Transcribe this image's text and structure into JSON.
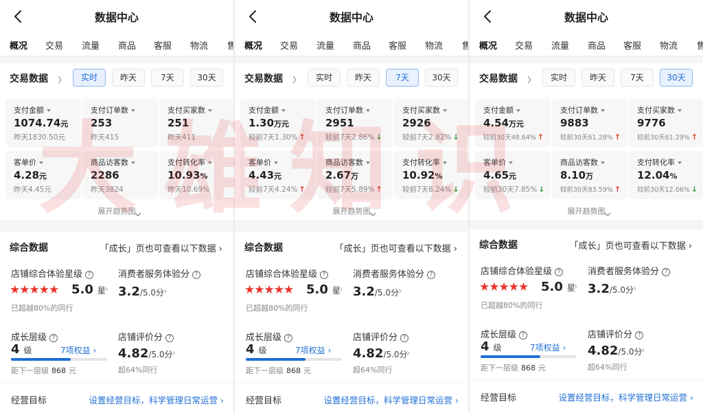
{
  "watermark": "大雄知识",
  "panels": [
    {
      "title": "数据中心",
      "tabs": [
        "概况",
        "交易",
        "流量",
        "商品",
        "客服",
        "物流",
        "售"
      ],
      "trade": {
        "title": "交易数据",
        "periods": [
          "实时",
          "昨天",
          "7天",
          "30天"
        ],
        "active_period": "实时",
        "metrics": [
          {
            "label": "支付金额",
            "value": "1074.74",
            "unit": "元",
            "sub": "昨天1830.50元",
            "trend": ""
          },
          {
            "label": "支付订单数",
            "value": "253",
            "unit": "",
            "sub": "昨天415",
            "trend": ""
          },
          {
            "label": "支付买家数",
            "value": "251",
            "unit": "",
            "sub": "昨天411",
            "trend": ""
          },
          {
            "label": "客单价",
            "value": "4.28",
            "unit": "元",
            "sub": "昨天4.45元",
            "trend": ""
          },
          {
            "label": "商品访客数",
            "value": "2286",
            "unit": "",
            "sub": "昨天3824",
            "trend": ""
          },
          {
            "label": "支付转化率",
            "value": "10.93",
            "unit": "%",
            "sub": "昨天10.69%",
            "trend": ""
          }
        ],
        "expand": "展开趋势图"
      },
      "summary": {
        "title": "综合数据",
        "link": "「成长」页也可查看以下数据",
        "rating_label": "店铺综合体验星级",
        "stars": "★★★★★",
        "rating_value": "5.0",
        "rating_unit": "星",
        "rating_note": "已超越80%的同行",
        "service_label": "消费者服务体验分",
        "service_value": "3.2",
        "service_unit": "/5.0分",
        "growth_label": "成长层级",
        "growth_value": "4",
        "growth_unit": "级",
        "growth_link": "7项权益",
        "growth_progress": 0.62,
        "growth_note_pre": "距下一层级",
        "growth_note_val": "868",
        "growth_note_unit": "元",
        "review_label": "店铺评价分",
        "review_value": "4.82",
        "review_unit": "/5.0分",
        "review_note": "超64%同行",
        "goal_label": "经营目标",
        "goal_link": "设置经营目标，科学管理日常运营"
      }
    },
    {
      "title": "数据中心",
      "tabs": [
        "概况",
        "交易",
        "流量",
        "商品",
        "客服",
        "物流",
        "售"
      ],
      "trade": {
        "title": "交易数据",
        "periods": [
          "实时",
          "昨天",
          "7天",
          "30天"
        ],
        "active_period": "7天",
        "metrics": [
          {
            "label": "支付金额",
            "value": "1.30",
            "unit": "万元",
            "sub": "较前7天1.30%",
            "trend": "up"
          },
          {
            "label": "支付订单数",
            "value": "2951",
            "unit": "",
            "sub": "较前7天2.86%",
            "trend": "down"
          },
          {
            "label": "支付买家数",
            "value": "2926",
            "unit": "",
            "sub": "较前7天2.82%",
            "trend": "down"
          },
          {
            "label": "客单价",
            "value": "4.43",
            "unit": "元",
            "sub": "较前7天4.24%",
            "trend": "up"
          },
          {
            "label": "商品访客数",
            "value": "2.67",
            "unit": "万",
            "sub": "较前7天5.89%",
            "trend": "up"
          },
          {
            "label": "支付转化率",
            "value": "10.92",
            "unit": "%",
            "sub": "较前7天8.24%",
            "trend": "down"
          }
        ],
        "expand": "展开趋势图"
      },
      "summary": {
        "title": "综合数据",
        "link": "「成长」页也可查看以下数据",
        "rating_label": "店铺综合体验星级",
        "stars": "★★★★★",
        "rating_value": "5.0",
        "rating_unit": "星",
        "rating_note": "已超越80%的同行",
        "service_label": "消费者服务体验分",
        "service_value": "3.2",
        "service_unit": "/5.0分",
        "growth_label": "成长层级",
        "growth_value": "4",
        "growth_unit": "级",
        "growth_link": "7项权益",
        "growth_progress": 0.62,
        "growth_note_pre": "距下一层级",
        "growth_note_val": "868",
        "growth_note_unit": "元",
        "review_label": "店铺评价分",
        "review_value": "4.82",
        "review_unit": "/5.0分",
        "review_note": "超64%同行",
        "goal_label": "经营目标",
        "goal_link": "设置经营目标，科学管理日常运营"
      }
    },
    {
      "title": "数据中心",
      "tabs": [
        "概况",
        "交易",
        "流量",
        "商品",
        "客服",
        "物流",
        "售"
      ],
      "trade": {
        "title": "交易数据",
        "periods": [
          "实时",
          "昨天",
          "7天",
          "30天"
        ],
        "active_period": "30天",
        "metrics": [
          {
            "label": "支付金额",
            "value": "4.54",
            "unit": "万元",
            "sub": "较前30天48.64%",
            "trend": "up"
          },
          {
            "label": "支付订单数",
            "value": "9883",
            "unit": "",
            "sub": "较前30天61.28%",
            "trend": "up"
          },
          {
            "label": "支付买家数",
            "value": "9776",
            "unit": "",
            "sub": "较前30天61.29%",
            "trend": "up"
          },
          {
            "label": "客单价",
            "value": "4.65",
            "unit": "元",
            "sub": "较前30天7.85%",
            "trend": "down"
          },
          {
            "label": "商品访客数",
            "value": "8.10",
            "unit": "万",
            "sub": "较前30天83.59%",
            "trend": "up"
          },
          {
            "label": "支付转化率",
            "value": "12.04",
            "unit": "%",
            "sub": "较前30天12.06%",
            "trend": "down"
          }
        ],
        "expand": "展开趋势图"
      },
      "summary": {
        "title": "综合数据",
        "link": "「成长」页也可查看以下数据",
        "rating_label": "店铺综合体验星级",
        "stars": "★★★★★",
        "rating_value": "5.0",
        "rating_unit": "星",
        "rating_note": "已超越80%的同行",
        "service_label": "消费者服务体验分",
        "service_value": "3.2",
        "service_unit": "/5.0分",
        "growth_label": "成长层级",
        "growth_value": "4",
        "growth_unit": "级",
        "growth_link": "7项权益",
        "growth_progress": 0.62,
        "growth_note_pre": "距下一层级",
        "growth_note_val": "868",
        "growth_note_unit": "元",
        "review_label": "店铺评价分",
        "review_value": "4.82",
        "review_unit": "/5.0分",
        "review_note": "超64%同行",
        "goal_label": "经营目标",
        "goal_link": "设置经营目标，科学管理日常运营"
      }
    }
  ]
}
